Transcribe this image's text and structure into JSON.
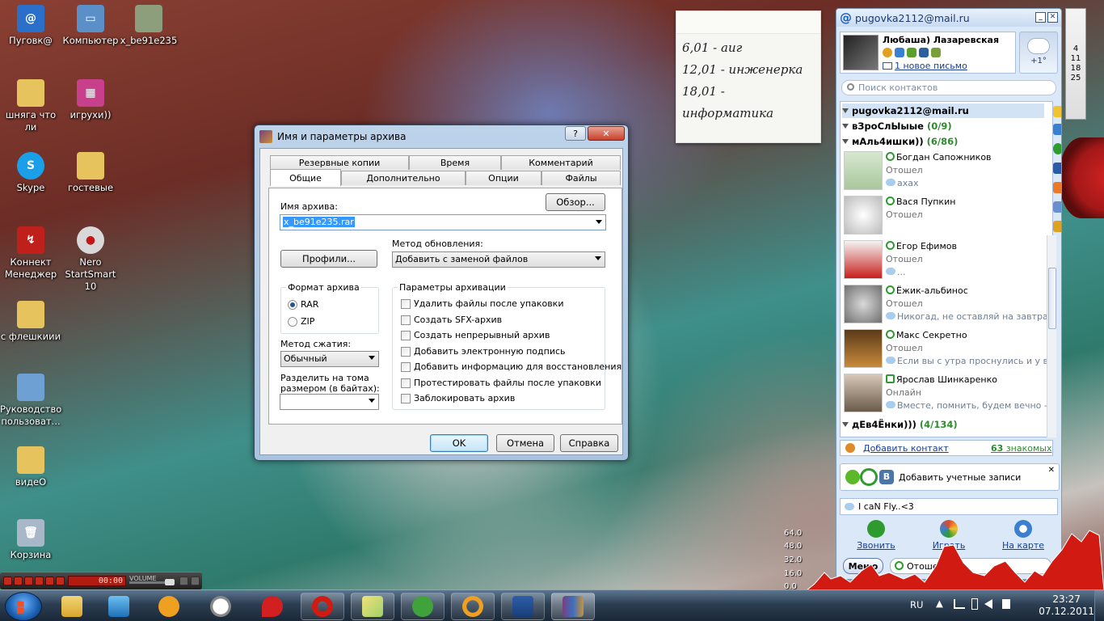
{
  "desktop": {
    "icons": [
      "Пуговк@",
      "Компьютер",
      "x_be91e235",
      "шняга что ли",
      "игрухи))",
      "Skype",
      "гостевые",
      "Коннект Менеджер",
      "Nero StartSmart 10",
      "с флешкиии",
      "Руководство пользоват...",
      "видеО",
      "Корзина"
    ]
  },
  "note": {
    "lines": [
      "6,01 - аиг",
      "12,01 - инженерка",
      "18,01 -",
      "информатика"
    ]
  },
  "dialog": {
    "title": "Имя и параметры архива",
    "help_btn": "?",
    "close_btn": "✕",
    "tabs_row1": [
      "Резервные копии",
      "Время",
      "Комментарий"
    ],
    "tabs_row2": [
      "Общие",
      "Дополнительно",
      "Опции",
      "Файлы"
    ],
    "archive_name_label": "Имя архива:",
    "browse_btn": "Обзор...",
    "archive_name_value": "x_be91e235.rar",
    "update_method_label": "Метод обновления:",
    "profiles_btn": "Профили...",
    "update_method_value": "Добавить с заменой файлов",
    "format_group": "Формат архива",
    "format_rar": "RAR",
    "format_zip": "ZIP",
    "compression_label": "Метод сжатия:",
    "compression_value": "Обычный",
    "split_label": "Разделить на тома размером (в байтах):",
    "split_value": "",
    "options_group": "Параметры архивации",
    "options": [
      "Удалить файлы после упаковки",
      "Создать SFX-архив",
      "Создать непрерывный архив",
      "Добавить электронную подпись",
      "Добавить информацию для восстановления",
      "Протестировать файлы после упаковки",
      "Заблокировать архив"
    ],
    "ok_btn": "OK",
    "cancel_btn": "Отмена",
    "help_text_btn": "Справка"
  },
  "agent": {
    "account": "pugovka2112@mail.ru",
    "profile_name": "Любаша) Лазаревская",
    "new_mail": "1 новое письмо",
    "weather": "+1°",
    "search_placeholder": "Поиск контактов",
    "group_self": "pugovka2112@mail.ru",
    "group1": "вЗроСлЫыые",
    "group1_count": "(0/9)",
    "group2": "мАль4ишки))",
    "group2_count": "(6/86)",
    "contacts": [
      {
        "name": "Богдан Сапожников",
        "status": "Отошел",
        "msg": "ахах"
      },
      {
        "name": "Вася Пупкин",
        "status": "Отошел",
        "msg": ""
      },
      {
        "name": "Егор Ефимов",
        "status": "Отошел",
        "msg": "..."
      },
      {
        "name": "Ёжик-альбинос",
        "status": "Отошел",
        "msg": "Никогад, не оставляй на завтра то, ч"
      },
      {
        "name": "Макс Секретно",
        "status": "Отошел",
        "msg": "Если вы с утра проснулись и у вас н"
      },
      {
        "name": "Ярослав Шинкаренко",
        "status": "Онлайн",
        "msg": "Вместе, помнить, будем вечно - быт"
      }
    ],
    "group3": "дЕв4Ёнки)))",
    "group3_count": "(4/134)",
    "add_contact": "Добавить контакт",
    "known_count": "63",
    "known_label": "знакомых",
    "add_accounts": "Добавить учетные записи",
    "status_text": "I caN Fly..<3",
    "actions": [
      "Звонить",
      "Играть",
      "На карте"
    ],
    "menu_btn": "Меню",
    "presence": "Отошел"
  },
  "calendar": {
    "days": [
      "4",
      "11",
      "18",
      "25"
    ]
  },
  "cpu_graph": {
    "labels": [
      "64.0",
      "48.0",
      "32.0",
      "16.0",
      "0.0"
    ]
  },
  "media": {
    "time": "00:00",
    "volume_label": "VOLUME"
  },
  "taskbar": {
    "lang": "RU",
    "time": "23:27",
    "date": "07.12.2011"
  },
  "colors": {
    "accent": "#3399ff",
    "taskbar": "#2c3e52",
    "agent_bg": "#dbe8f8"
  }
}
